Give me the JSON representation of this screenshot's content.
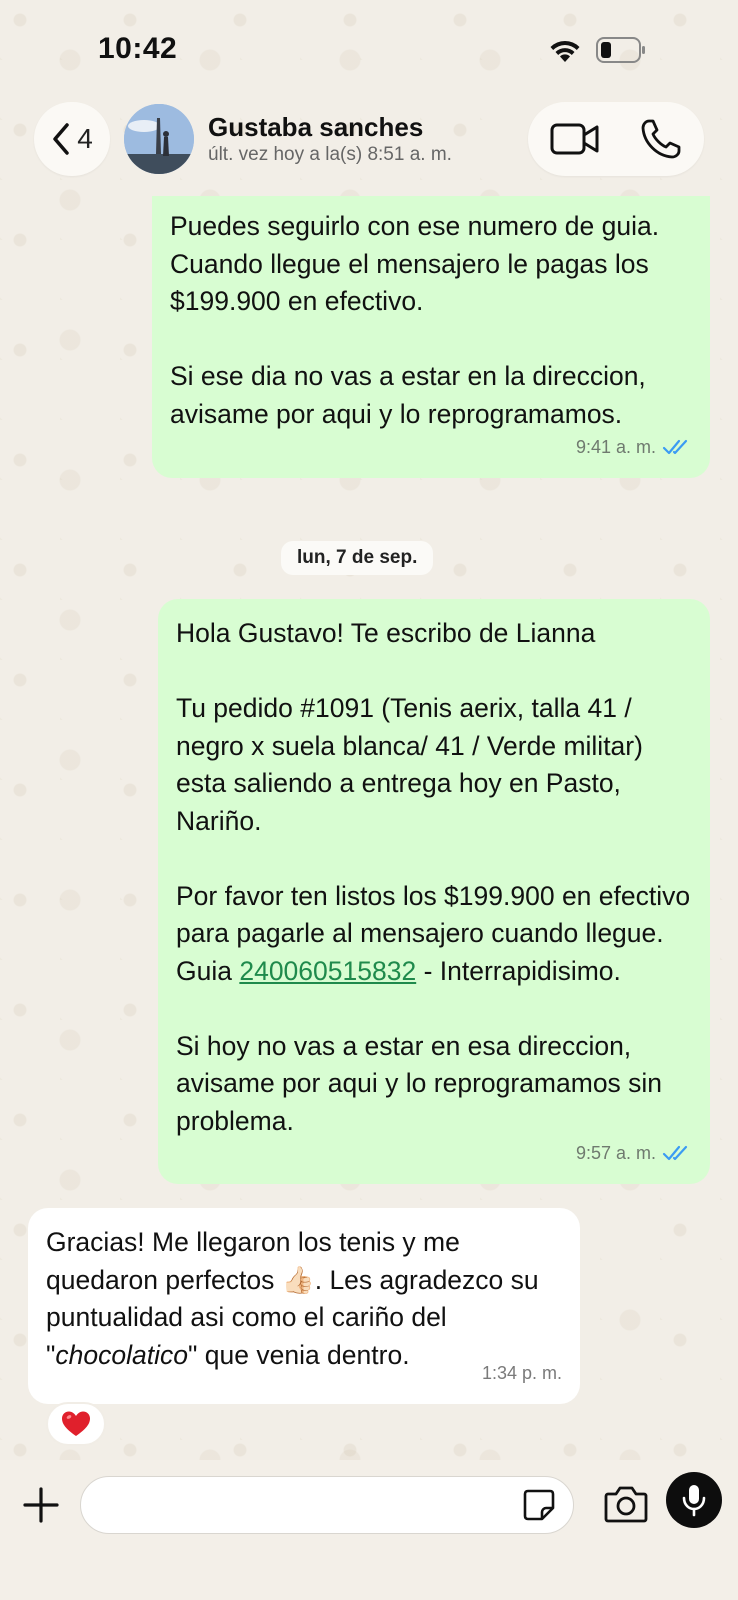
{
  "status_bar": {
    "time": "10:42"
  },
  "header": {
    "back_count": "4",
    "contact_name": "Gustaba sanches",
    "last_seen": "últ. vez hoy a la(s) 8:51 a. m."
  },
  "messages": [
    {
      "direction": "outgoing",
      "text": "Puedes seguirlo con ese numero de guia. Cuando llegue el mensajero le pagas los $199.900 en efectivo.\n\nSi ese dia no vas a estar en la direccion, avisame por aqui y lo reprogramamos.",
      "time": "9:41 a. m.",
      "status": "read"
    },
    {
      "direction": "outgoing",
      "text_before_link": "Hola Gustavo! Te escribo de Lianna\n\nTu pedido #1091 (Tenis aerix, talla 41 / negro x suela blanca/ 41 / Verde militar) esta saliendo a entrega hoy en Pasto, Nariño.\n\nPor favor ten listos los $199.900 en efectivo para pagarle al mensajero cuando llegue.\nGuia ",
      "link": "240060515832",
      "text_after_link": " - Interrapidisimo.\n\nSi hoy no vas a estar en esa direccion, avisame por aqui y lo reprogramamos sin problema.",
      "time": "9:57 a. m.",
      "status": "read"
    },
    {
      "direction": "incoming",
      "text_1": "Gracias! Me llegaron los tenis y me quedaron perfectos ",
      "emoji": "👍🏻",
      "text_2": ". Les agradezco su puntualidad asi como el cariño del \"",
      "italic": "chocolatico",
      "text_3": "\" que venia dentro.",
      "time": "1:34 p. m.",
      "reaction": "❤️"
    }
  ],
  "date_separator": "lun, 7 de sep.",
  "input": {
    "value": "",
    "placeholder": ""
  },
  "colors": {
    "outgoing_bubble": "#d8fdd2",
    "incoming_bubble": "#ffffff",
    "read_ticks": "#3b9bf3",
    "link": "#1f8a4c",
    "wallpaper": "#f2eee7"
  },
  "icons": [
    "wifi-icon",
    "battery-icon",
    "back-chevron-icon",
    "video-call-icon",
    "phone-call-icon",
    "plus-icon",
    "sticker-icon",
    "camera-icon",
    "microphone-icon",
    "double-check-icon",
    "heart-icon"
  ]
}
